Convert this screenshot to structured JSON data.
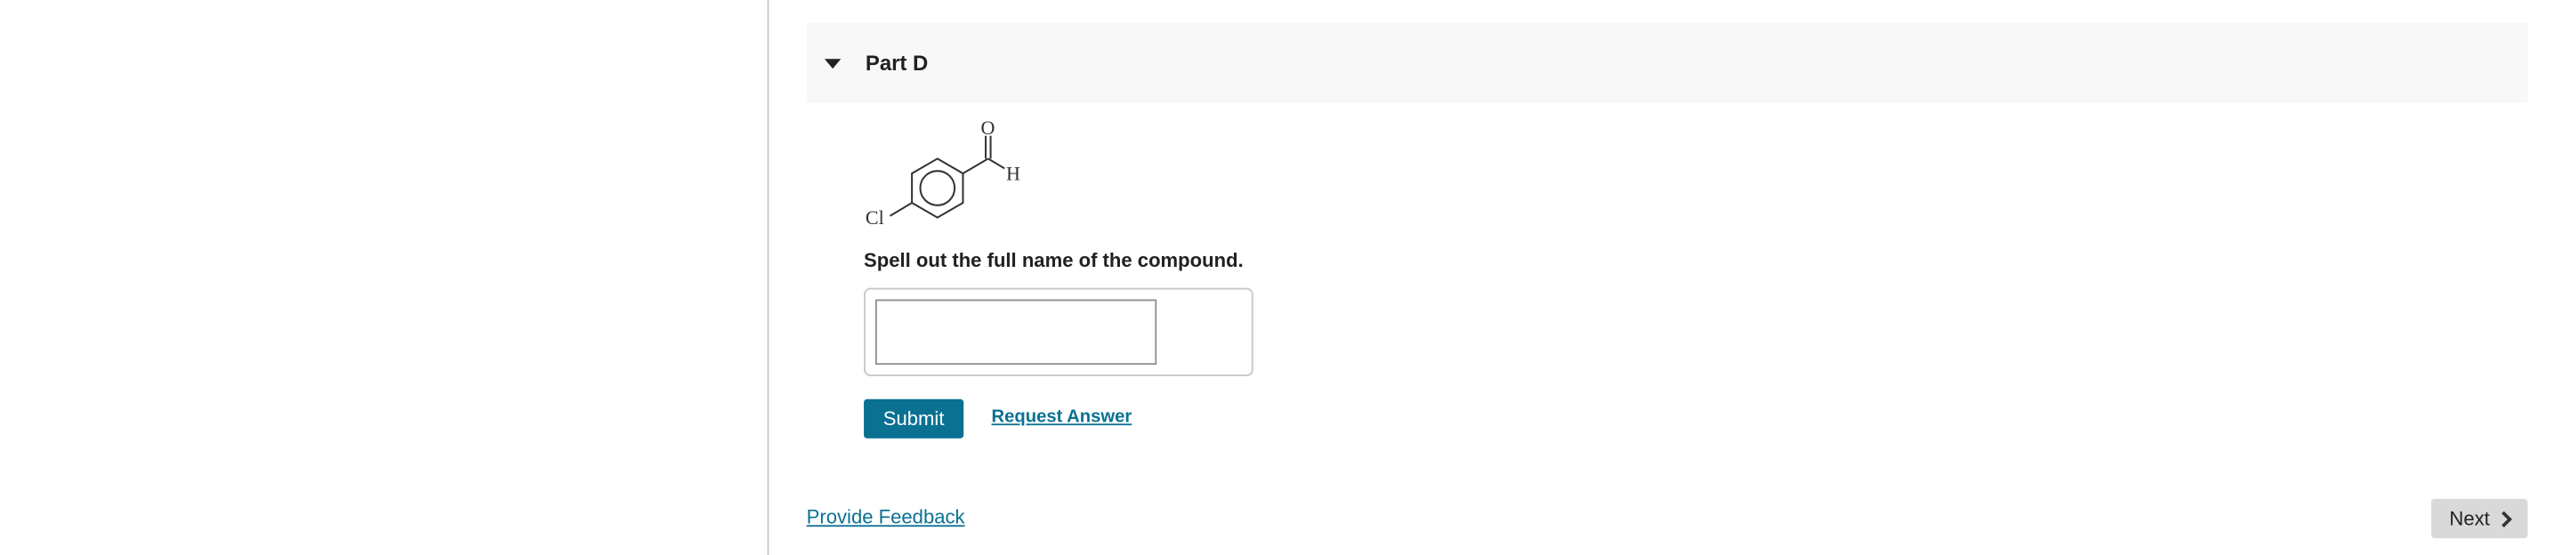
{
  "part": {
    "title": "Part D"
  },
  "structure": {
    "atoms": {
      "oxygen": "O",
      "hydrogen": "H",
      "chlorine": "Cl"
    }
  },
  "question": {
    "prompt": "Spell out the full name of the compound."
  },
  "answer": {
    "value": "",
    "placeholder": ""
  },
  "actions": {
    "submit_label": "Submit",
    "request_answer_label": "Request Answer"
  },
  "footer": {
    "feedback_label": "Provide Feedback",
    "next_label": "Next"
  },
  "colors": {
    "accent": "#0a7193",
    "header_bg": "#f8f8f8",
    "next_bg": "#d9d9d9"
  },
  "icons": {
    "collapse": "caret-down-icon",
    "next": "chevron-right-icon"
  }
}
